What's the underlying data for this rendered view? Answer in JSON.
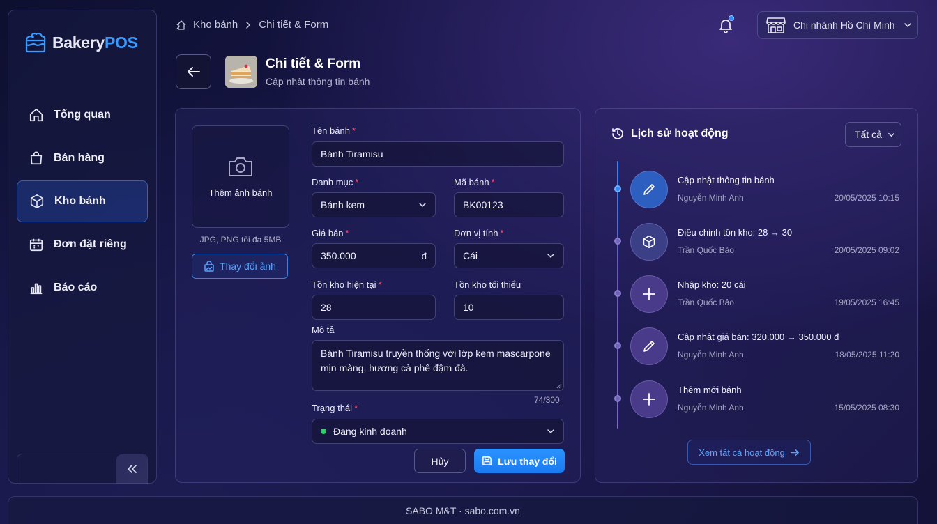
{
  "app": {
    "logo_main": "Bakery",
    "logo_accent": "POS"
  },
  "sidebar": {
    "items": [
      {
        "label": "Tổng quan",
        "icon": "home-icon"
      },
      {
        "label": "Bán hàng",
        "icon": "shopping-bag-icon"
      },
      {
        "label": "Kho bánh",
        "icon": "box-icon",
        "active": true
      },
      {
        "label": "Đơn đặt riêng",
        "icon": "calendar-icon"
      },
      {
        "label": "Báo cáo",
        "icon": "bar-chart-icon"
      }
    ]
  },
  "breadcrumb": {
    "root": "Kho bánh",
    "current": "Chi tiết & Form"
  },
  "topbar": {
    "branch": "Chi nhánh Hồ Chí Minh"
  },
  "header": {
    "title": "Chi tiết & Form",
    "subtitle": "Cập nhật thông tin bánh"
  },
  "form": {
    "photo": {
      "add_label": "Thêm ảnh bánh",
      "hint": "JPG, PNG tối đa 5MB",
      "change_label": "Thay đổi ảnh"
    },
    "name": {
      "label": "Tên bánh",
      "value": "Bánh Tiramisu"
    },
    "category": {
      "label": "Danh mục",
      "value": "Bánh kem"
    },
    "code": {
      "label": "Mã bánh",
      "value": "BK00123"
    },
    "price": {
      "label": "Giá bán",
      "value": "350.000",
      "suffix": "đ"
    },
    "unit": {
      "label": "Đơn vị tính",
      "value": "Cái"
    },
    "stock": {
      "label": "Tồn kho hiện tại",
      "value": "28"
    },
    "min_stock": {
      "label": "Tồn kho tối thiểu",
      "value": "10"
    },
    "description": {
      "label": "Mô tả",
      "value": "Bánh Tiramisu truyền thống với lớp kem mascarpone mịn màng, hương cà phê đậm đà.",
      "counter": "74/300"
    },
    "status": {
      "label": "Trạng thái",
      "value": "Đang kinh doanh",
      "color": "#2fd36a"
    },
    "required_mark": "*",
    "cancel_label": "Hủy",
    "save_label": "Lưu thay đổi"
  },
  "activity": {
    "title": "Lịch sử hoạt động",
    "filter": "Tất cả",
    "items": [
      {
        "text": "Cập nhật thông tin bánh",
        "user": "Nguyễn Minh Anh",
        "time": "20/05/2025 10:15",
        "icon": "pencil-icon"
      },
      {
        "text": "Điều chỉnh tồn kho: 28 → 30",
        "user": "Trần Quốc Bảo",
        "time": "20/05/2025 09:02",
        "icon": "box-icon"
      },
      {
        "text": "Nhập kho: 20 cái",
        "user": "Trần Quốc Bảo",
        "time": "19/05/2025 16:45",
        "icon": "plus-icon"
      },
      {
        "text": "Cập nhật giá bán: 320.000 → 350.000 đ",
        "user": "Nguyễn Minh Anh",
        "time": "18/05/2025 11:20",
        "icon": "pencil-icon"
      },
      {
        "text": "Thêm mới bánh",
        "user": "Nguyễn Minh Anh",
        "time": "15/05/2025 08:30",
        "icon": "plus-icon"
      }
    ],
    "view_all": "Xem tất cả hoạt động"
  },
  "footer": {
    "text": "SABO M&T · sabo.com.vn"
  },
  "colors": {
    "accent": "#2f8bff",
    "danger": "#ff4d6a",
    "success": "#2fd36a"
  }
}
